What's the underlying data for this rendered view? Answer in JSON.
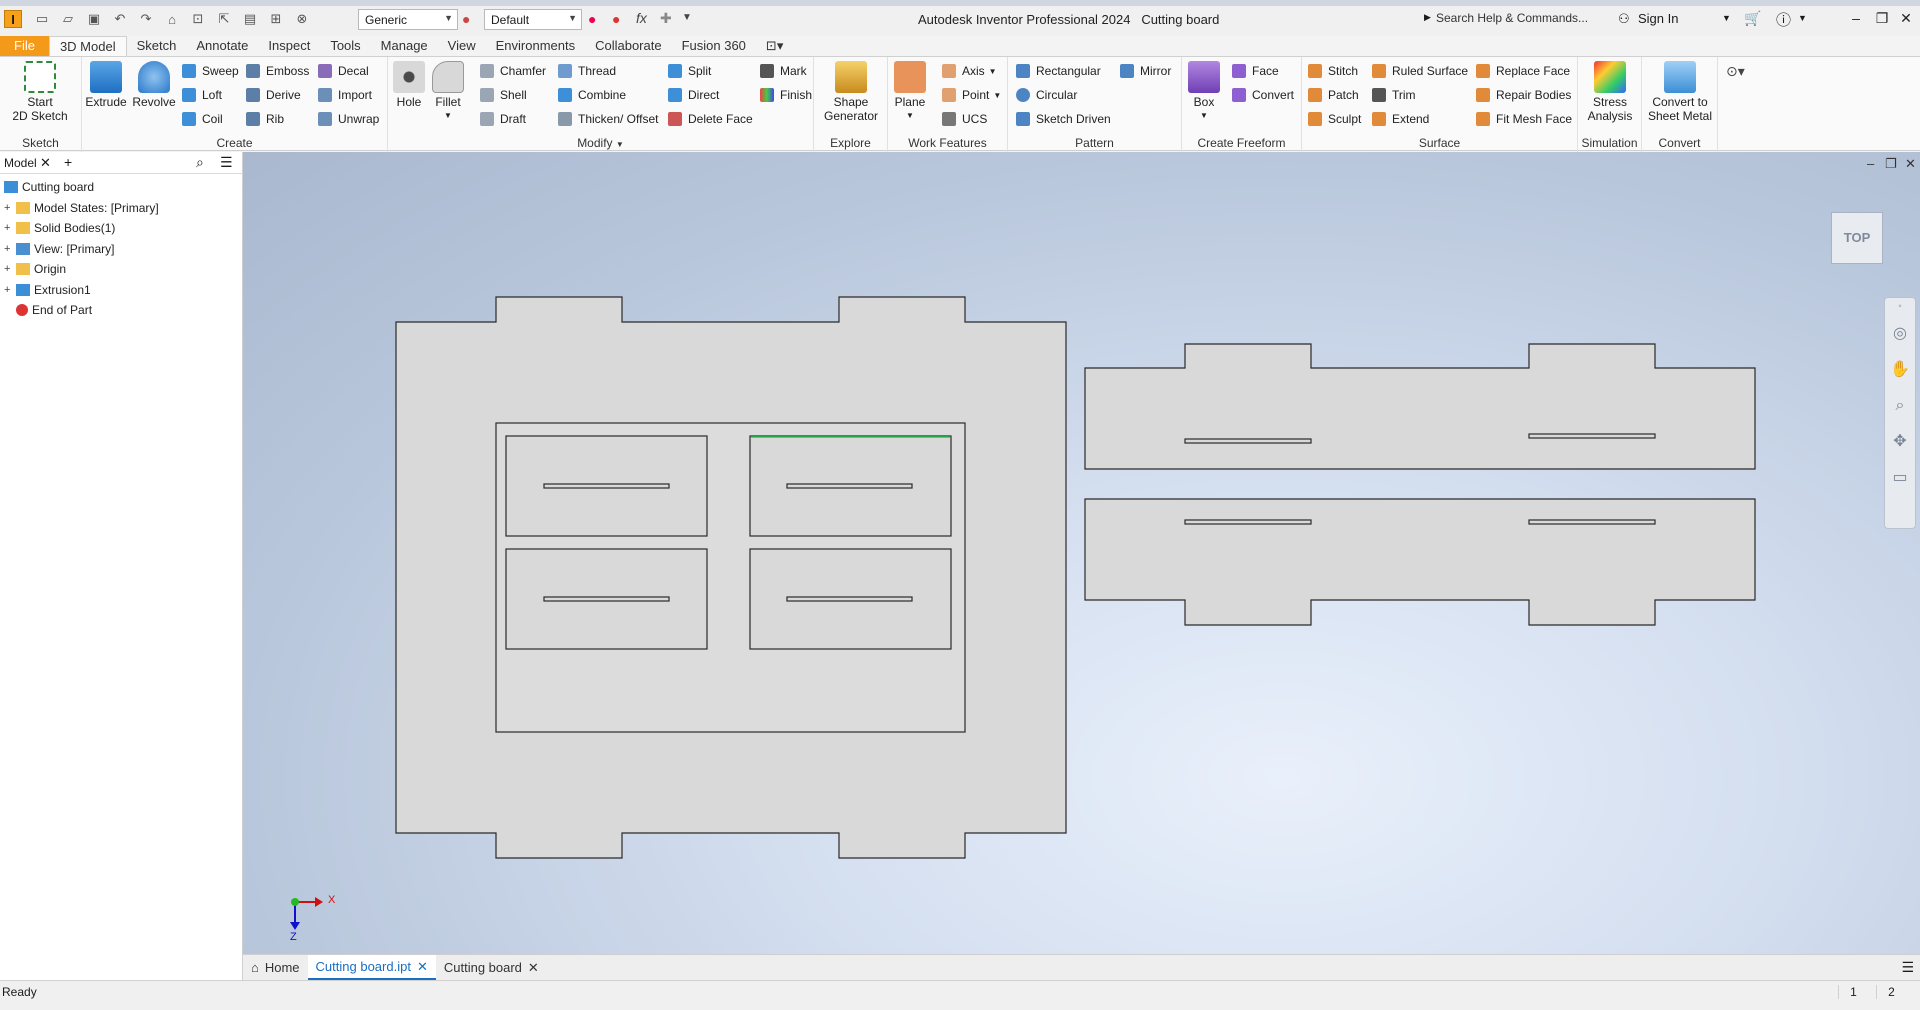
{
  "app": {
    "title": "Autodesk Inventor Professional 2024",
    "document": "Cutting board",
    "logo_letter": "I"
  },
  "qat": {
    "material": "Generic",
    "appearance": "Default",
    "fx_label": "fx"
  },
  "search": {
    "placeholder": "Search Help & Commands..."
  },
  "account": {
    "signin": "Sign In"
  },
  "tabs": [
    "File",
    "3D Model",
    "Sketch",
    "Annotate",
    "Inspect",
    "Tools",
    "Manage",
    "View",
    "Environments",
    "Collaborate",
    "Fusion 360"
  ],
  "ribbon": {
    "sketch": {
      "title": "Sketch",
      "start": "Start",
      "start2": "2D Sketch"
    },
    "create": {
      "title": "Create",
      "extrude": "Extrude",
      "revolve": "Revolve",
      "sweep": "Sweep",
      "loft": "Loft",
      "coil": "Coil",
      "emboss": "Emboss",
      "derive": "Derive",
      "rib": "Rib",
      "decal": "Decal",
      "import": "Import",
      "unwrap": "Unwrap"
    },
    "modify": {
      "title": "Modify",
      "hole": "Hole",
      "fillet": "Fillet",
      "chamfer": "Chamfer",
      "shell": "Shell",
      "draft": "Draft",
      "thread": "Thread",
      "combine": "Combine",
      "thicken": "Thicken/ Offset",
      "split": "Split",
      "direct": "Direct",
      "delete_face": "Delete Face",
      "mark": "Mark",
      "finish": "Finish"
    },
    "explore": {
      "title": "Explore",
      "shape1": "Shape",
      "shape2": "Generator"
    },
    "work": {
      "title": "Work Features",
      "plane": "Plane",
      "axis": "Axis",
      "point": "Point",
      "ucs": "UCS"
    },
    "pattern": {
      "title": "Pattern",
      "rectangular": "Rectangular",
      "circular": "Circular",
      "sketch_driven": "Sketch Driven",
      "mirror": "Mirror"
    },
    "freeform": {
      "title": "Create Freeform",
      "box": "Box",
      "face": "Face",
      "convert": "Convert"
    },
    "surface": {
      "title": "Surface",
      "stitch": "Stitch",
      "patch": "Patch",
      "sculpt": "Sculpt",
      "ruled": "Ruled Surface",
      "trim": "Trim",
      "extend": "Extend",
      "replace": "Replace Face",
      "repair": "Repair Bodies",
      "fitmesh": "Fit Mesh Face"
    },
    "simulation": {
      "title": "Simulation",
      "stress1": "Stress",
      "stress2": "Analysis"
    },
    "convert": {
      "title": "Convert",
      "c1": "Convert to",
      "c2": "Sheet Metal"
    }
  },
  "browser": {
    "tab": "Model",
    "items": [
      {
        "label": "Cutting board",
        "expandable": false,
        "indent": 0
      },
      {
        "label": "Model States: [Primary]",
        "expandable": true,
        "indent": 1
      },
      {
        "label": "Solid Bodies(1)",
        "expandable": true,
        "indent": 1
      },
      {
        "label": "View: [Primary]",
        "expandable": true,
        "indent": 1
      },
      {
        "label": "Origin",
        "expandable": true,
        "indent": 1
      },
      {
        "label": "Extrusion1",
        "expandable": true,
        "indent": 1
      },
      {
        "label": "End of Part",
        "expandable": false,
        "indent": 1
      }
    ]
  },
  "viewport": {
    "viewcube": "TOP",
    "axis_x": "X",
    "axis_z": "Z"
  },
  "doctabs": {
    "home": "Home",
    "tab1": "Cutting board.ipt",
    "tab2": "Cutting board"
  },
  "status": {
    "text": "Ready",
    "n1": "1",
    "n2": "2"
  },
  "colors": {
    "accent": "#f49a1a",
    "selected_edge": "#22cc55",
    "active_tab": "#1b6ec2"
  }
}
